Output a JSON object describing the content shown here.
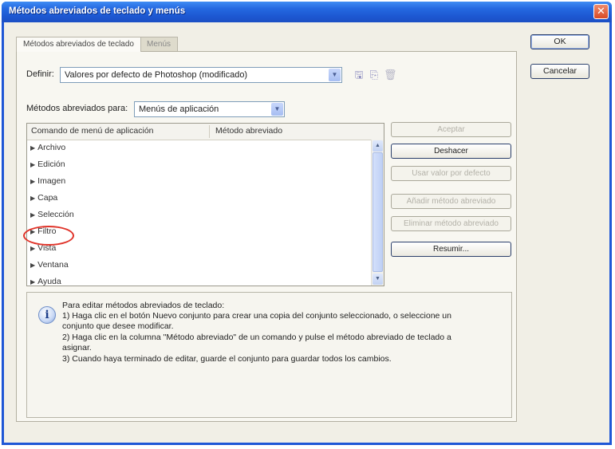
{
  "window": {
    "title": "Métodos abreviados de teclado y menús",
    "close_symbol": "✕"
  },
  "tabs": [
    {
      "label": "Métodos abreviados de teclado",
      "active": true
    },
    {
      "label": "Menús",
      "active": false
    }
  ],
  "definir": {
    "label": "Definir:",
    "value": "Valores por defecto de Photoshop (modificado)"
  },
  "set_icons": [
    "save-icon",
    "save-as-icon",
    "delete-icon"
  ],
  "metodos_para": {
    "label": "Métodos abreviados para:",
    "value": "Menús de aplicación"
  },
  "table": {
    "columns": [
      "Comando de menú de aplicación",
      "Método abreviado"
    ],
    "rows": [
      "Archivo",
      "Edición",
      "Imagen",
      "Capa",
      "Selección",
      "Filtro",
      "Vista",
      "Ventana",
      "Ayuda"
    ]
  },
  "side_buttons": {
    "aceptar": "Aceptar",
    "deshacer": "Deshacer",
    "usar_valor": "Usar valor por defecto",
    "anadir": "Añadir método abreviado",
    "eliminar": "Eliminar método abreviado",
    "resumir": "Resumir..."
  },
  "dialog_buttons": {
    "ok": "OK",
    "cancelar": "Cancelar"
  },
  "info": {
    "lines": [
      "Para editar métodos abreviados de teclado:",
      "1) Haga clic en el botón Nuevo conjunto para crear una copia del conjunto seleccionado, o seleccione un",
      "conjunto que desee modificar.",
      "2) Haga clic en la columna \"Método abreviado\" de un comando y pulse el método abreviado de teclado a",
      "asignar.",
      "3) Cuando haya terminado de editar, guarde el conjunto para guardar todos los cambios."
    ]
  },
  "colors": {
    "titlebar": "#1d58d2",
    "highlight": "#e0342a"
  }
}
